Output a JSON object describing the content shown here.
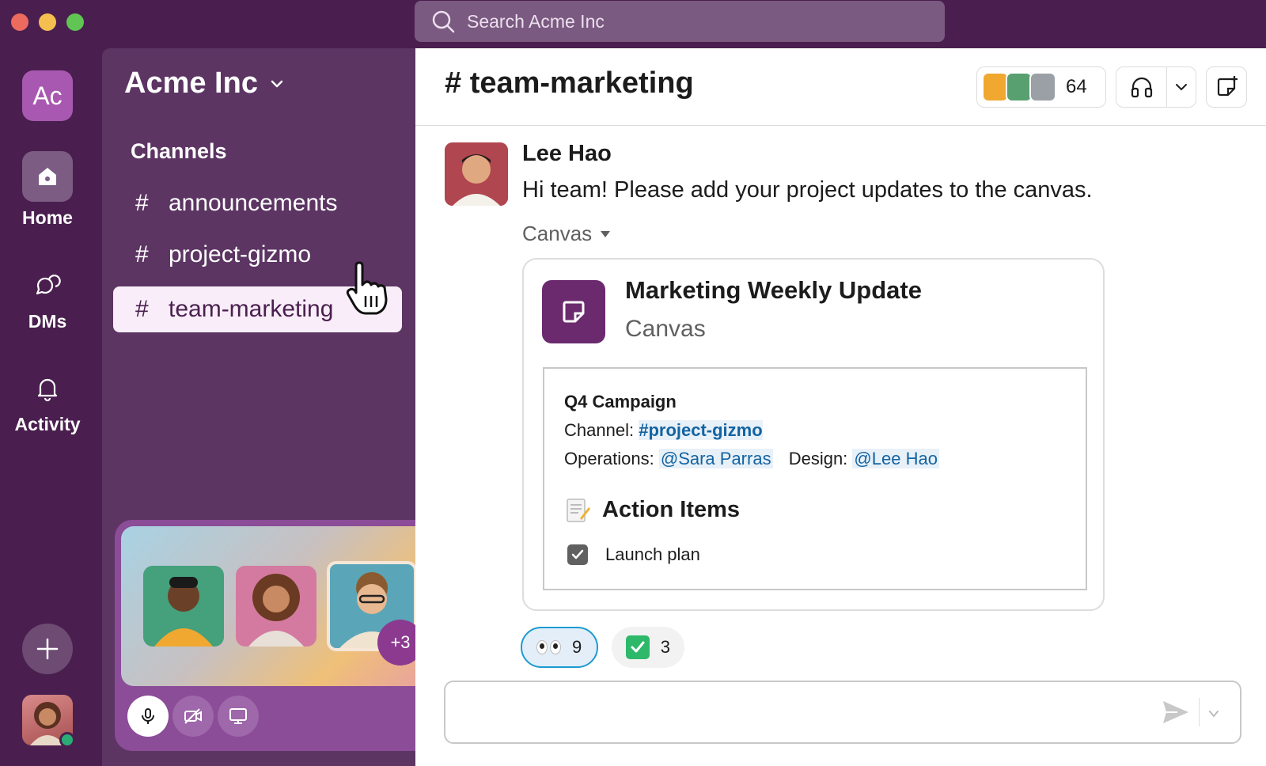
{
  "search": {
    "placeholder": "Search Acme Inc"
  },
  "workspace": {
    "initials": "Ac",
    "name": "Acme Inc"
  },
  "rail": {
    "items": [
      {
        "label": "Home",
        "icon": "home-icon"
      },
      {
        "label": "DMs",
        "icon": "dms-icon"
      },
      {
        "label": "Activity",
        "icon": "bell-icon"
      }
    ],
    "add_icon": "plus-icon"
  },
  "sidebar": {
    "section_title": "Channels",
    "channels": [
      {
        "name": "announcements",
        "active": false
      },
      {
        "name": "project-gizmo",
        "active": false
      },
      {
        "name": "team-marketing",
        "active": true
      }
    ]
  },
  "huddle": {
    "extra_count": "+3"
  },
  "channel": {
    "title": "# team-marketing",
    "member_count": "64"
  },
  "message": {
    "author": "Lee Hao",
    "text": "Hi team! Please add your project updates to the canvas.",
    "attachment_label": "Canvas",
    "canvas": {
      "title": "Marketing Weekly Update",
      "subtitle": "Canvas",
      "heading": "Q4 Campaign",
      "channel_label": "Channel:",
      "channel_link": "#project-gizmo",
      "ops_label": "Operations:",
      "ops_mention": "@Sara Parras",
      "design_label": "Design:",
      "design_mention": "@Lee Hao",
      "action_items_title": "Action Items",
      "checklist": [
        {
          "label": "Launch plan",
          "checked": true
        }
      ]
    },
    "reactions": [
      {
        "emoji": "eyes",
        "count": "9"
      },
      {
        "emoji": "white-check-mark",
        "count": "3"
      }
    ]
  },
  "colors": {
    "aubergine": "#4a1f4f",
    "sidebar": "#5c3563",
    "link": "#1264a3",
    "active_channel_bg": "#f8edf8"
  }
}
